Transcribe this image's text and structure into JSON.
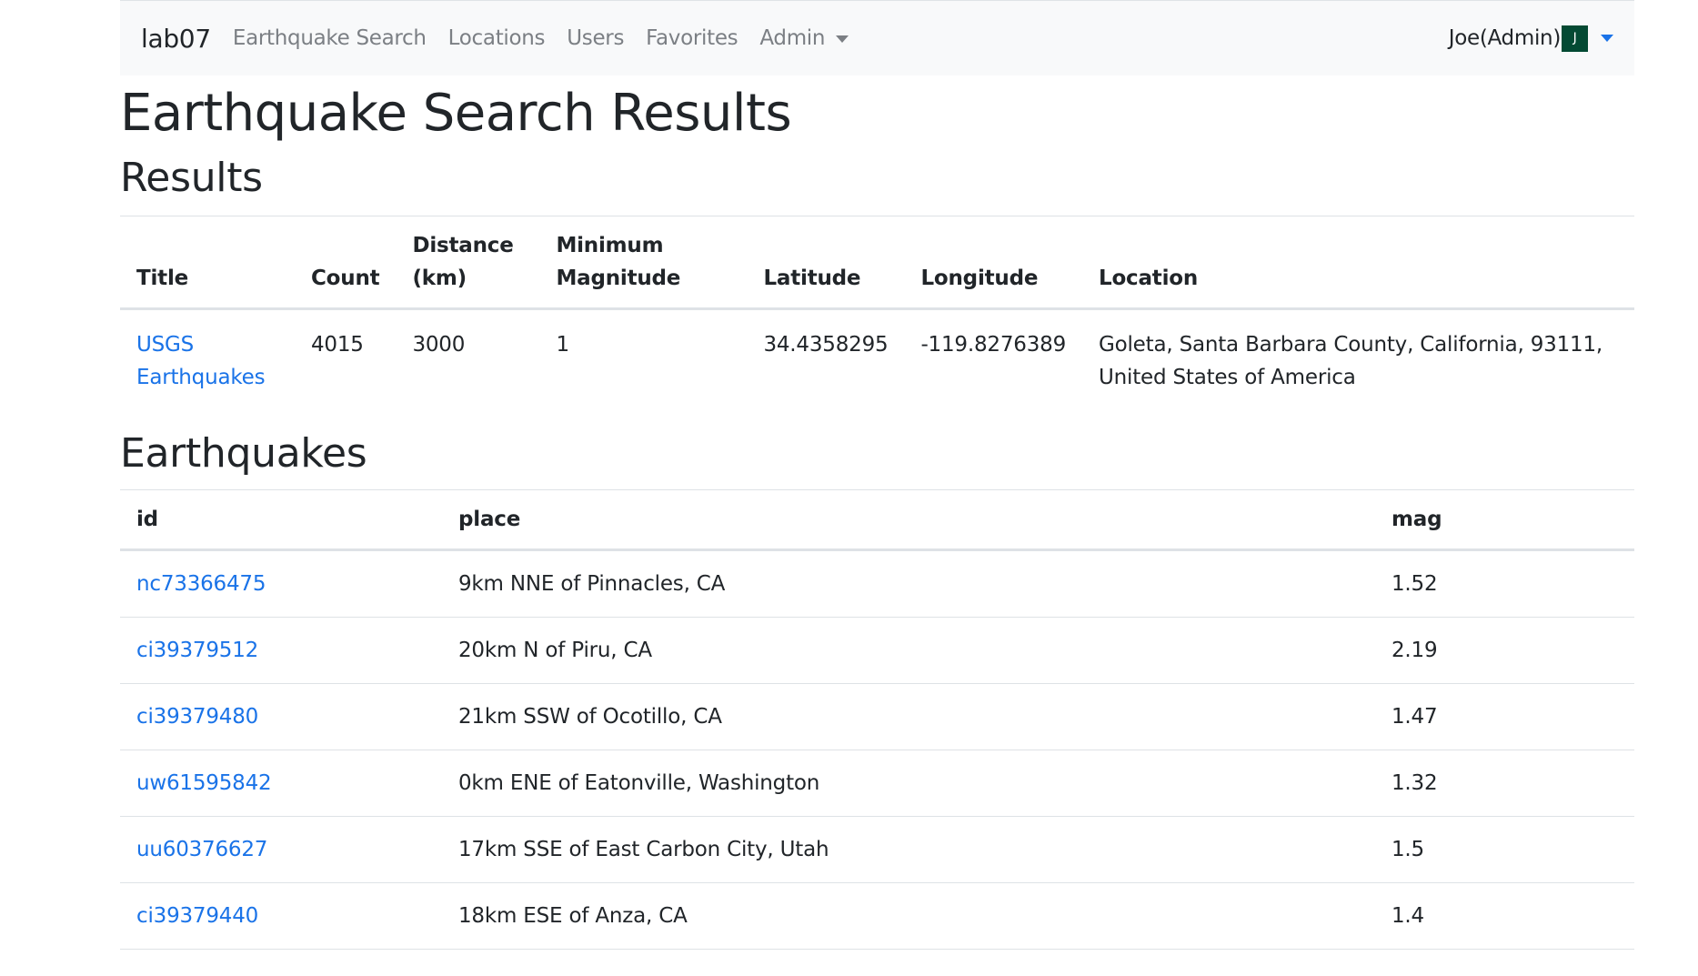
{
  "navbar": {
    "brand": "lab07",
    "links": [
      "Earthquake Search",
      "Locations",
      "Users",
      "Favorites"
    ],
    "admin_label": "Admin",
    "user_label": "Joe(Admin)",
    "avatar_letter": "J"
  },
  "page_title": "Earthquake Search Results",
  "results": {
    "heading": "Results",
    "columns": {
      "title": "Title",
      "count": "Count",
      "distance_1": "Distance",
      "distance_2": "(km)",
      "minmag_1": "Minimum",
      "minmag_2": "Magnitude",
      "latitude": "Latitude",
      "longitude": "Longitude",
      "location": "Location"
    },
    "row": {
      "title_1": "USGS",
      "title_2": "Earthquakes",
      "count": "4015",
      "distance": "3000",
      "min_magnitude": "1",
      "latitude": "34.4358295",
      "longitude": "-119.8276389",
      "location_1": "Goleta, Santa Barbara County, California, 93111,",
      "location_2": "United States of America"
    }
  },
  "earthquakes": {
    "heading": "Earthquakes",
    "columns": {
      "id": "id",
      "place": "place",
      "mag": "mag"
    },
    "rows": [
      {
        "id": "nc73366475",
        "place": "9km NNE of Pinnacles, CA",
        "mag": "1.52"
      },
      {
        "id": "ci39379512",
        "place": "20km N of Piru, CA",
        "mag": "2.19"
      },
      {
        "id": "ci39379480",
        "place": "21km SSW of Ocotillo, CA",
        "mag": "1.47"
      },
      {
        "id": "uw61595842",
        "place": "0km ENE of Eatonville, Washington",
        "mag": "1.32"
      },
      {
        "id": "uu60376627",
        "place": "17km SSE of East Carbon City, Utah",
        "mag": "1.5"
      },
      {
        "id": "ci39379440",
        "place": "18km ESE of Anza, CA",
        "mag": "1.4"
      }
    ]
  },
  "colors": {
    "link": "#1a73e8",
    "navbar_bg": "#f8f9fa",
    "avatar_bg": "#044a33"
  }
}
